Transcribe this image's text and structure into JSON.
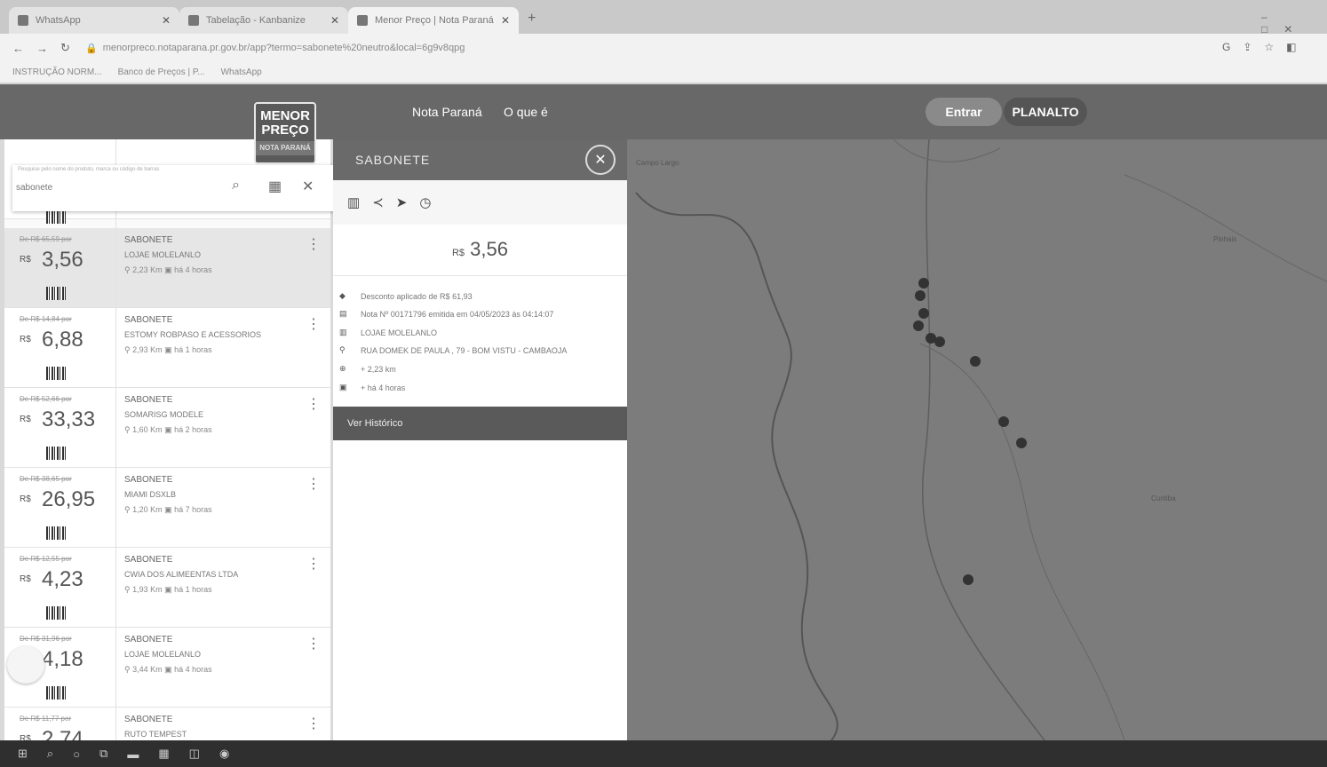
{
  "browser": {
    "tabs": [
      {
        "label": "WhatsApp"
      },
      {
        "label": "Tabelação - Kanbanize"
      },
      {
        "label": "Menor Preço | Nota Paraná"
      }
    ],
    "new_tab": "+",
    "url": "menorpreco.notaparana.pr.gov.br/app?termo=sabonete%20neutro&local=6g9v8qpg",
    "bookmarks": [
      "INSTRUÇÃO NORM...",
      "Banco de Preços | P...",
      "WhatsApp"
    ]
  },
  "header": {
    "logo_line1": "MENOR",
    "logo_line2": "PREÇO",
    "logo_sub": "NOTA PARANÁ",
    "nav": [
      "Nota Paraná",
      "O que é"
    ],
    "entrar": "Entrar",
    "location": "PLANALTO"
  },
  "search": {
    "hint": "Pesquise pelo nome do produto, marca ou código de barras",
    "value": "sabonete"
  },
  "currency": "R$",
  "results": [
    {
      "old": "De R$ 65,59 por",
      "price": "3,56",
      "product": "SABONETE",
      "store": "LOJAE MOLELANLO",
      "distance": "2,23 Km",
      "time": "há 4 horas"
    },
    {
      "old": "De R$ 14,84 por",
      "price": "6,88",
      "product": "SABONETE",
      "store": "ESTOMY ROBPASO E ACESSORIOS",
      "distance": "2,93 Km",
      "time": "há 1 horas"
    },
    {
      "old": "De R$ 52,66 por",
      "price": "33,33",
      "product": "SABONETE",
      "store": "SOMARISG MODELE",
      "distance": "1,60 Km",
      "time": "há 2 horas"
    },
    {
      "old": "De R$ 38,65 por",
      "price": "26,95",
      "product": "SABONETE",
      "store": "MIAMI DSXLB",
      "distance": "1,20 Km",
      "time": "há 7 horas"
    },
    {
      "old": "De R$ 12,55 por",
      "price": "4,23",
      "product": "SABONETE",
      "store": "CWIA DOS ALIMEENTAS LTDA",
      "distance": "1,93 Km",
      "time": "há 1 horas"
    },
    {
      "old": "De R$ 31,96 por",
      "price": "4,18",
      "product": "SABONETE",
      "store": "LOJAE MOLELANLO",
      "distance": "3,44 Km",
      "time": "há 4 horas"
    },
    {
      "old": "De R$ 11,77 por",
      "price": "2,74",
      "product": "SABONETE",
      "store": "RUTO TEMPEST",
      "distance": "",
      "time": ""
    }
  ],
  "detail": {
    "title": "SABONETE",
    "price": "3,56",
    "discount": "Desconto aplicado de R$ 61,93",
    "nota": "Nota Nº 00171796 emitida em 04/05/2023 às 04:14:07",
    "store": "LOJAE MOLELANLO",
    "address": "RUA DOMEK DE PAULA , 79 - BOM VISTU - CAMBAOJA",
    "distance": "+ 2,23 km",
    "time": "+ há 4 horas",
    "history_button": "Ver Histórico"
  },
  "map": {
    "labels": [
      "Campo Largo",
      "Pinhais",
      "Curitiba"
    ]
  }
}
